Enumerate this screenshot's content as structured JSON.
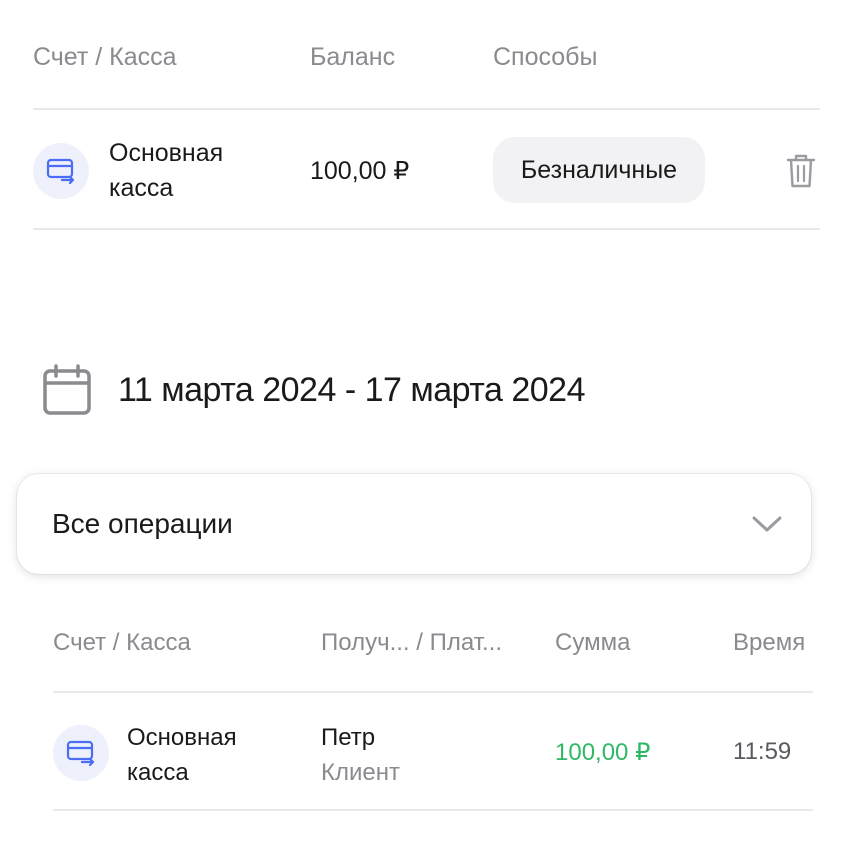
{
  "accounts_table": {
    "headers": {
      "account": "Счет / Касса",
      "balance": "Баланс",
      "methods": "Способы"
    },
    "row": {
      "name_line1": "Основная",
      "name_line2": "касса",
      "balance": "100,00 ₽",
      "method": "Безналичные",
      "icon": "card-transfer-icon",
      "delete_icon": "trash-icon"
    }
  },
  "date_range": {
    "icon": "calendar-icon",
    "label": "11 марта 2024 - 17 марта 2024"
  },
  "operations_filter": {
    "selected": "Все операции",
    "icon": "chevron-down-icon"
  },
  "operations_table": {
    "headers": {
      "account": "Счет / Касса",
      "counterparty": "Получ... / Плат...",
      "amount": "Сумма",
      "time": "Время"
    },
    "rows": [
      {
        "account_line1": "Основная",
        "account_line2": "касса",
        "counterparty_name": "Петр",
        "counterparty_role": "Клиент",
        "amount": "100,00 ₽",
        "time": "11:59"
      }
    ]
  },
  "colors": {
    "accent": "#4a6cf7",
    "positive": "#2fb866",
    "muted": "#8a8a8f"
  }
}
